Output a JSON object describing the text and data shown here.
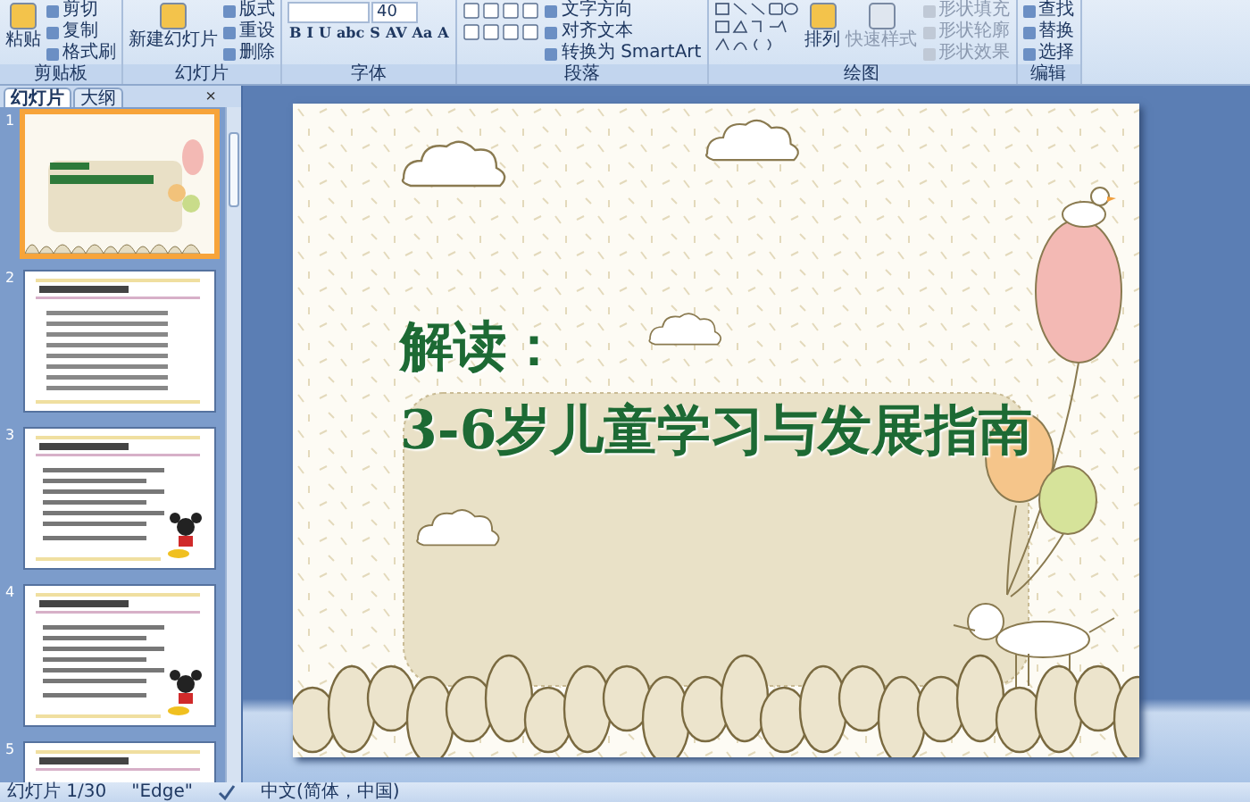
{
  "ribbon": {
    "groups": [
      {
        "label": "剪贴板",
        "kind": "clipboard",
        "large": [
          {
            "label": "粘贴",
            "disabled": false
          }
        ],
        "small": [
          {
            "label": "剪切",
            "disabled": false
          },
          {
            "label": "复制",
            "disabled": false
          },
          {
            "label": "格式刷",
            "disabled": false
          }
        ]
      },
      {
        "label": "幻灯片",
        "kind": "slides",
        "large": [
          {
            "label": "新建幻灯片",
            "disabled": false
          }
        ],
        "small": [
          {
            "label": "版式",
            "disabled": false
          },
          {
            "label": "重设",
            "disabled": false
          },
          {
            "label": "删除",
            "disabled": false
          }
        ]
      },
      {
        "label": "字体",
        "kind": "font",
        "font_size": "40",
        "format_buttons": [
          "B",
          "I",
          "U",
          "abc",
          "S",
          "AV",
          "Aa",
          "A"
        ]
      },
      {
        "label": "段落",
        "kind": "paragraph",
        "small": [
          {
            "label": "文字方向",
            "disabled": false
          },
          {
            "label": "对齐文本",
            "disabled": false
          },
          {
            "label": "转换为 SmartArt",
            "disabled": false
          }
        ]
      },
      {
        "label": "绘图",
        "kind": "drawing",
        "large": [
          {
            "label": "排列",
            "disabled": false
          },
          {
            "label": "快速样式",
            "disabled": true
          }
        ],
        "small": [
          {
            "label": "形状填充",
            "disabled": true
          },
          {
            "label": "形状轮廓",
            "disabled": true
          },
          {
            "label": "形状效果",
            "disabled": true
          }
        ]
      },
      {
        "label": "编辑",
        "kind": "editing",
        "small": [
          {
            "label": "查找",
            "disabled": false
          },
          {
            "label": "替换",
            "disabled": false
          },
          {
            "label": "选择",
            "disabled": false
          }
        ]
      }
    ]
  },
  "slide_panel": {
    "tabs": [
      {
        "label": "幻灯片",
        "selected": true
      },
      {
        "label": "大纲",
        "selected": false
      }
    ],
    "close": "×",
    "thumbnails": [
      {
        "number": "1",
        "kind": "title",
        "selected": true
      },
      {
        "number": "2",
        "kind": "text",
        "selected": false
      },
      {
        "number": "3",
        "kind": "cartoon",
        "selected": false
      },
      {
        "number": "4",
        "kind": "cartoon",
        "selected": false
      },
      {
        "number": "5",
        "kind": "text",
        "selected": false
      }
    ]
  },
  "slide": {
    "title_lines": [
      "解读：",
      "3-6岁儿童学习与发展指南"
    ]
  },
  "status_bar": {
    "slide_count": "幻灯片 1/30",
    "theme": "\"Edge\"",
    "language": "中文(简体，中国)"
  }
}
